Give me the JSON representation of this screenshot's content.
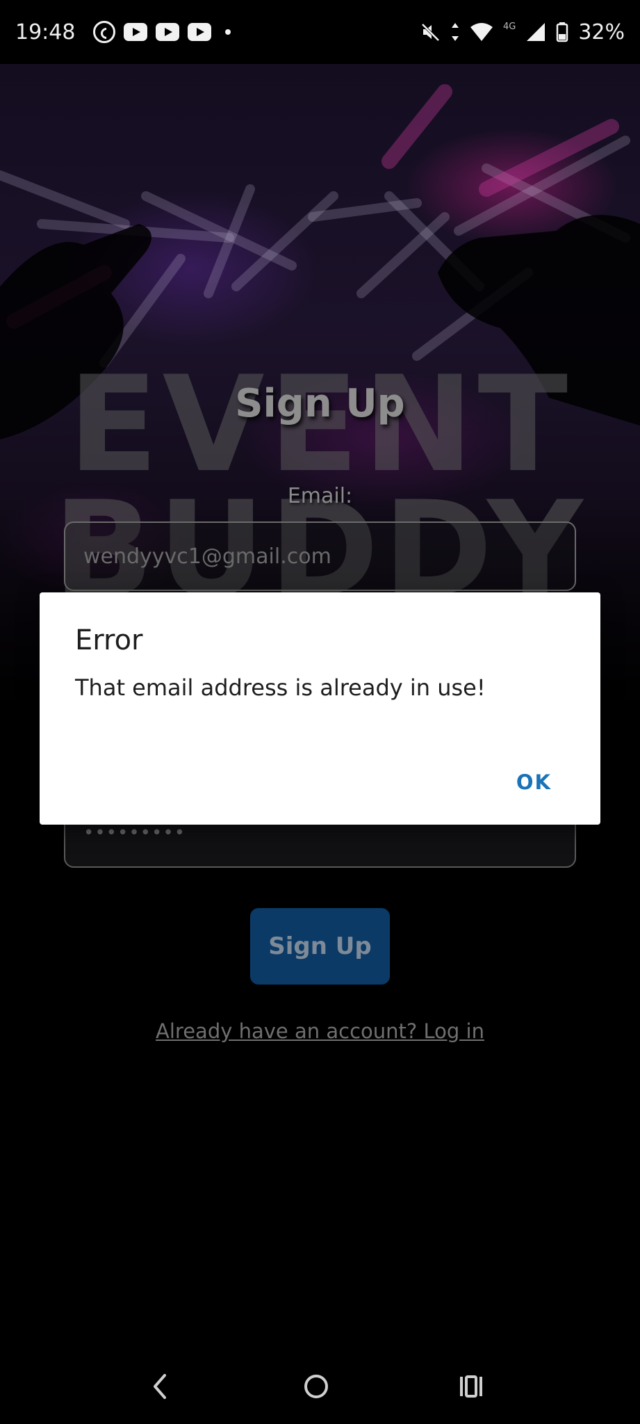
{
  "status_bar": {
    "time": "19:48",
    "notification_icons": [
      "whatsapp-icon",
      "youtube-icon",
      "youtube-icon",
      "youtube-icon",
      "dot-icon"
    ],
    "battery": "32%",
    "network": "4G"
  },
  "background": {
    "logo_line1": "EVENT",
    "logo_line2": "BUDDY"
  },
  "form": {
    "title": "Sign Up",
    "email_label": "Email:",
    "email_value": "wendyyvc1@gmail.com",
    "password_value": "•••••••••",
    "submit_label": "Sign Up",
    "login_link": "Already have an account? Log in"
  },
  "dialog": {
    "title": "Error",
    "message": "That email address is already in use!",
    "ok_label": "OK"
  },
  "colors": {
    "dialog_accent": "#1a73b8",
    "submit_bg": "#0b3a66"
  }
}
